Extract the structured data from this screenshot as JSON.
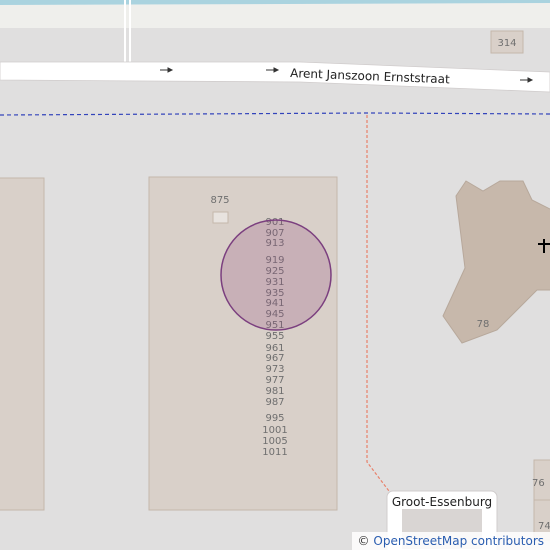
{
  "map": {
    "street_name": "Arent Janszoon Ernststraat",
    "place_label": "Groot-Essenburg",
    "landmark_icon": "church-cross-icon",
    "building_numbers": [
      "314",
      "875",
      "78",
      "76",
      "74"
    ],
    "address_column": [
      "901",
      "907",
      "913",
      "919",
      "925",
      "931",
      "935",
      "941",
      "945",
      "951",
      "955",
      "961",
      "967",
      "973",
      "977",
      "981",
      "987",
      "995",
      "1001",
      "1005",
      "1011"
    ]
  },
  "attribution": {
    "symbol": "©",
    "text": "OpenStreetMap contributors"
  },
  "colors": {
    "background": "#e0dfdf",
    "building": "#d9d0c9",
    "building_outline": "#c5b7ab",
    "church": "#c7b8ab",
    "water": "#aad3df",
    "road": "#ffffff",
    "boundary_blue": "#3344bb",
    "footpath_red": "#e8806a",
    "marker_fill": "rgba(150, 80, 130, 0.25)",
    "marker_stroke": "#7b3f7f"
  }
}
